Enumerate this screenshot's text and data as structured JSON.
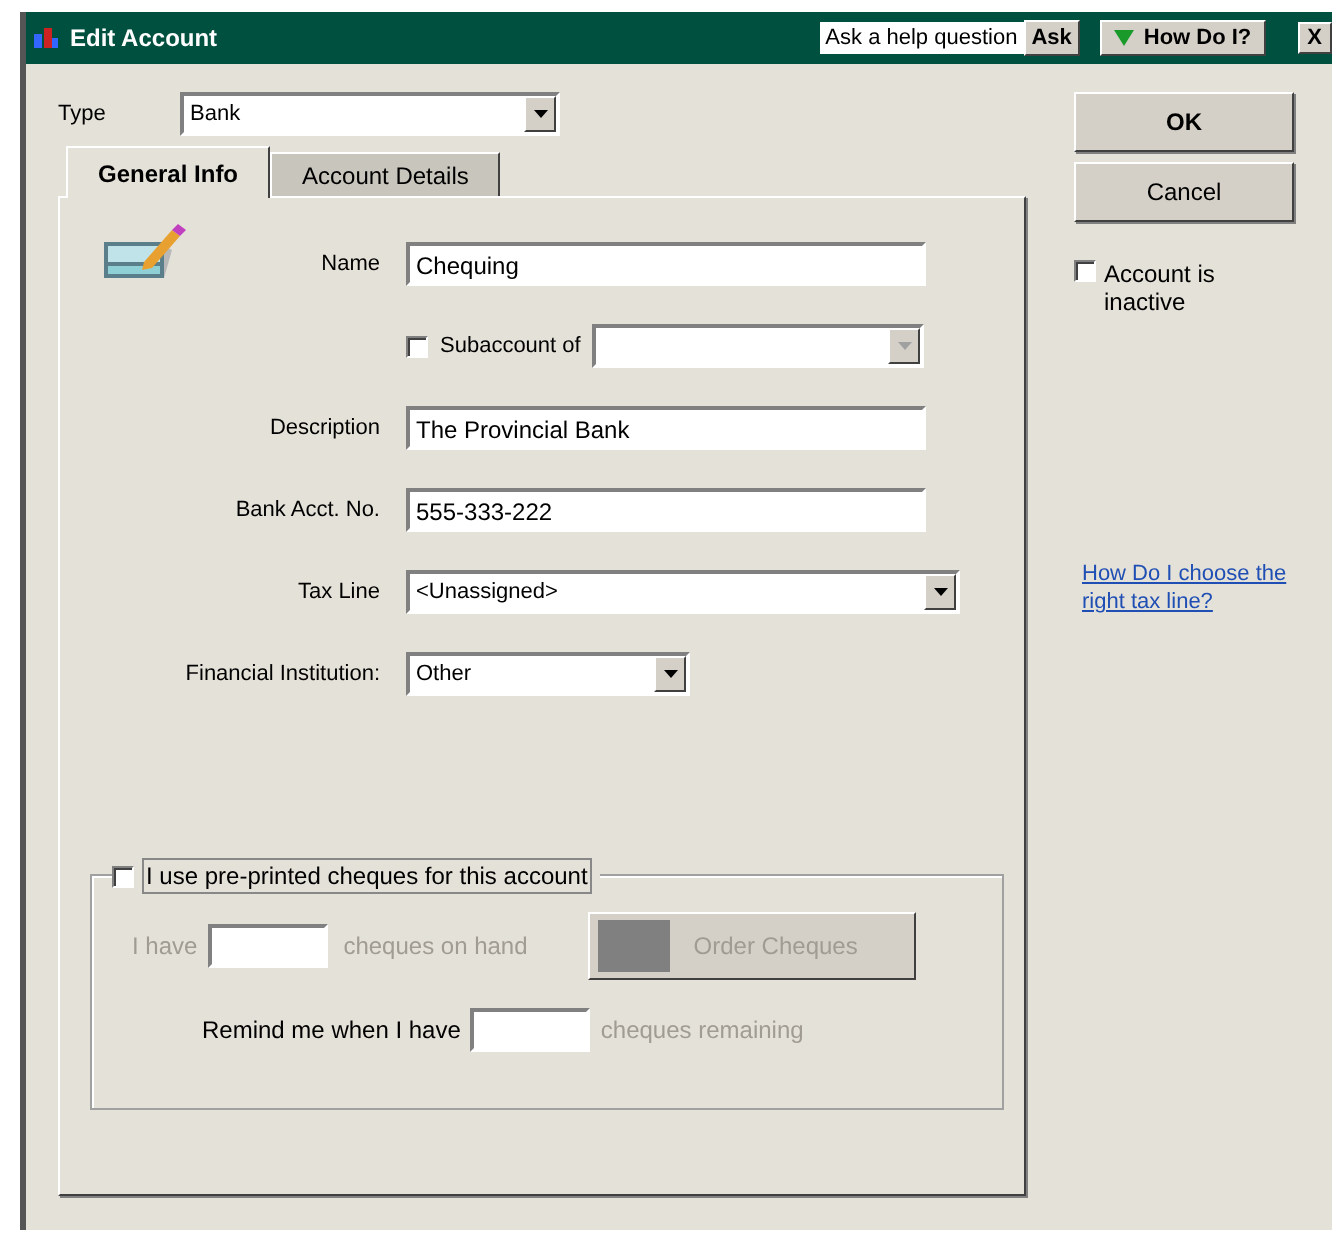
{
  "window": {
    "title": "Edit Account",
    "close": "X"
  },
  "help": {
    "question": "Ask a help question",
    "ask": "Ask",
    "how_do_i": "How Do I?"
  },
  "type": {
    "label": "Type",
    "value": "Bank"
  },
  "tabs": [
    {
      "label": "General Info",
      "selected": true
    },
    {
      "label": "Account Details",
      "selected": false
    }
  ],
  "fields": [
    {
      "kind": "text",
      "label": "Name",
      "value": "Chequing"
    },
    {
      "kind": "subaccount",
      "label": "Subaccount of",
      "checked": false,
      "disabled": true
    },
    {
      "kind": "text",
      "label": "Description",
      "value": "The Provincial Bank"
    },
    {
      "kind": "text",
      "label": "Bank Acct. No.",
      "value": "555-333-222"
    },
    {
      "kind": "combo",
      "label": "Tax Line",
      "value": "<Unassigned>"
    },
    {
      "kind": "short-combo",
      "label": "Financial Institution:",
      "value": "Other"
    }
  ],
  "cheques": {
    "label": "I use pre-printed cheques for this account",
    "checked": false,
    "rows": [
      {
        "prefix": "I have",
        "suffix": "cheques on hand",
        "disabled": true
      },
      {
        "prefix": "Remind me when I have",
        "suffix": "cheques remaining",
        "disabled": false
      }
    ],
    "order_button": {
      "label": "Order Cheques",
      "disabled": true
    }
  },
  "buttons": [
    {
      "label": "OK"
    },
    {
      "label": "Cancel"
    }
  ],
  "inactive": {
    "label": "Account is inactive",
    "checked": false
  },
  "link": "How Do I choose the right tax line?"
}
